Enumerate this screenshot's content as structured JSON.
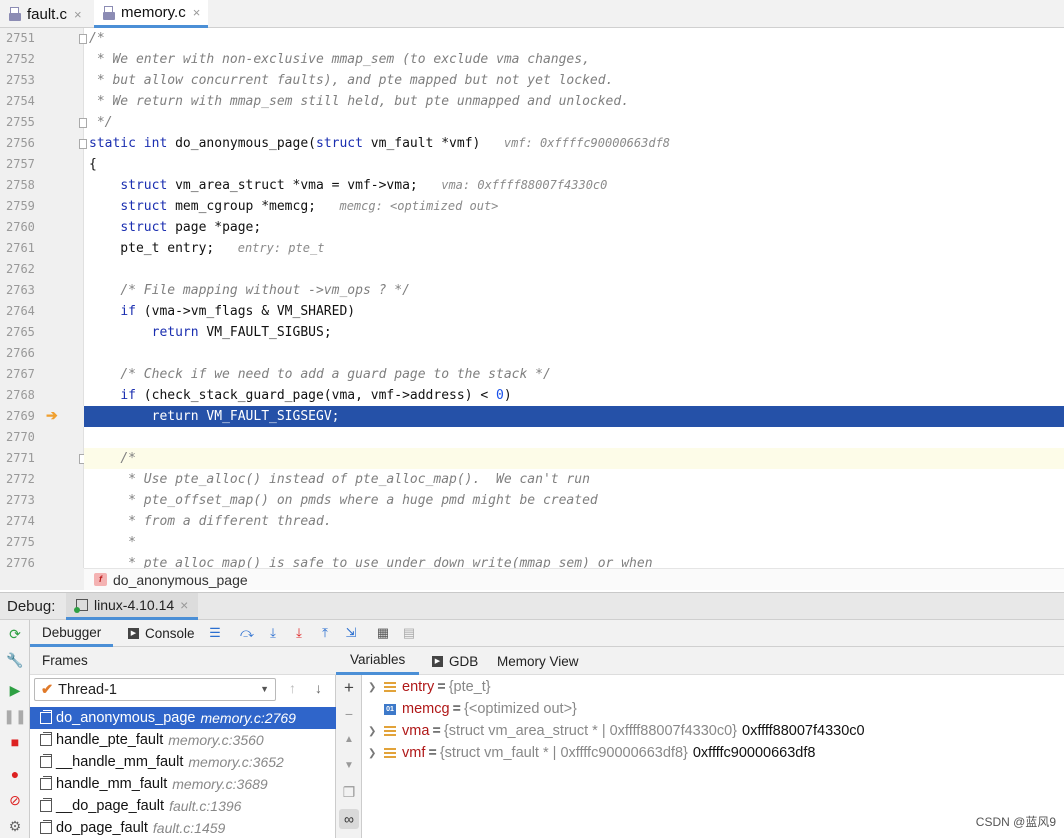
{
  "tabs": [
    {
      "label": "fault.c",
      "close": "×"
    },
    {
      "label": "memory.c",
      "close": "×"
    }
  ],
  "code_lines": [
    {
      "n": "2751",
      "html": "<span class=\"cmt\">/*</span>"
    },
    {
      "n": "2752",
      "html": "<span class=\"cmt\"> * We enter with non-exclusive mmap_sem (to exclude vma changes,</span>"
    },
    {
      "n": "2753",
      "html": "<span class=\"cmt\"> * but allow concurrent faults), and pte mapped but not yet locked.</span>"
    },
    {
      "n": "2754",
      "html": "<span class=\"cmt\"> * We return with mmap_sem still held, but pte unmapped and unlocked.</span>"
    },
    {
      "n": "2755",
      "html": "<span class=\"cmt\"> */</span>"
    },
    {
      "n": "2756",
      "html": "<span class=\"kw\">static int</span> do_anonymous_page(<span class=\"kw\">struct</span> vm_fault *vmf)   <span class=\"hint\">vmf: 0xffffc90000663df8</span>"
    },
    {
      "n": "2757",
      "html": "{"
    },
    {
      "n": "2758",
      "html": "    <span class=\"kw\">struct</span> vm_area_struct *vma = vmf-&gt;vma;   <span class=\"hint\">vma: 0xffff88007f4330c0</span>"
    },
    {
      "n": "2759",
      "html": "    <span class=\"kw\">struct</span> mem_cgroup *memcg;   <span class=\"hint\">memcg: &lt;optimized out&gt;</span>"
    },
    {
      "n": "2760",
      "html": "    <span class=\"kw\">struct</span> page *page;"
    },
    {
      "n": "2761",
      "html": "    pte_t entry;   <span class=\"hint\">entry: pte_t</span>"
    },
    {
      "n": "2762",
      "html": ""
    },
    {
      "n": "2763",
      "html": "    <span class=\"cmt\">/* File mapping without -&gt;vm_ops ? */</span>"
    },
    {
      "n": "2764",
      "html": "    <span class=\"kw\">if</span> (vma-&gt;vm_flags &amp; VM_SHARED)"
    },
    {
      "n": "2765",
      "html": "        <span class=\"kw\">return</span> VM_FAULT_SIGBUS;"
    },
    {
      "n": "2766",
      "html": ""
    },
    {
      "n": "2767",
      "html": "    <span class=\"cmt\">/* Check if we need to add a guard page to the stack */</span>"
    },
    {
      "n": "2768",
      "html": "    <span class=\"kw\">if</span> (check_stack_guard_page(vma, vmf-&gt;address) &lt; <span class=\"num\">0</span>)"
    },
    {
      "n": "2769",
      "html": "        <span class=\"kw\">return</span> VM_FAULT_SIGSEGV;"
    },
    {
      "n": "2770",
      "html": ""
    },
    {
      "n": "2771",
      "html": "    <span class=\"cmt\">/*</span>"
    },
    {
      "n": "2772",
      "html": "<span class=\"cmt\">     * Use pte_alloc() instead of pte_alloc_map().  We can't run</span>"
    },
    {
      "n": "2773",
      "html": "<span class=\"cmt\">     * pte_offset_map() on pmds where a huge pmd might be created</span>"
    },
    {
      "n": "2774",
      "html": "<span class=\"cmt\">     * from a different thread.</span>"
    },
    {
      "n": "2775",
      "html": "<span class=\"cmt\">     *</span>"
    },
    {
      "n": "2776",
      "html": "<span class=\"cmt\">     * pte_alloc_map() is safe to use under down_write(mmap_sem) or when</span>"
    }
  ],
  "breadcrumb": {
    "badge": "f",
    "label": "do_anonymous_page"
  },
  "debug": {
    "title": "Debug:",
    "session": "linux-4.10.14",
    "session_close": "×"
  },
  "subtabs": {
    "debugger": "Debugger",
    "console": "Console"
  },
  "frames": {
    "header": "Frames",
    "thread": "Thread-1",
    "items": [
      {
        "fn": "do_anonymous_page",
        "loc": "memory.c:2769"
      },
      {
        "fn": "handle_pte_fault",
        "loc": "memory.c:3560"
      },
      {
        "fn": "__handle_mm_fault",
        "loc": "memory.c:3652"
      },
      {
        "fn": "handle_mm_fault",
        "loc": "memory.c:3689"
      },
      {
        "fn": "__do_page_fault",
        "loc": "fault.c:1396"
      },
      {
        "fn": "do_page_fault",
        "loc": "fault.c:1459"
      }
    ]
  },
  "var_tabs": {
    "variables": "Variables",
    "gdb": "GDB",
    "memory": "Memory View"
  },
  "variables": [
    {
      "name": "entry",
      "eq": "=",
      "value": "{pte_t}",
      "raw": ""
    },
    {
      "name": "memcg",
      "eq": "=",
      "value": "{<optimized out>}",
      "raw": ""
    },
    {
      "name": "vma",
      "eq": "=",
      "value": "{struct vm_area_struct * | 0xffff88007f4330c0}",
      "raw": "0xffff88007f4330c0"
    },
    {
      "name": "vmf",
      "eq": "=",
      "value": "{struct vm_fault * | 0xffffc90000663df8}",
      "raw": "0xffffc90000663df8"
    }
  ],
  "watermark": "CSDN @蓝风9",
  "colors": {
    "selection": "#2551a8",
    "accent": "#4b8fd6"
  }
}
